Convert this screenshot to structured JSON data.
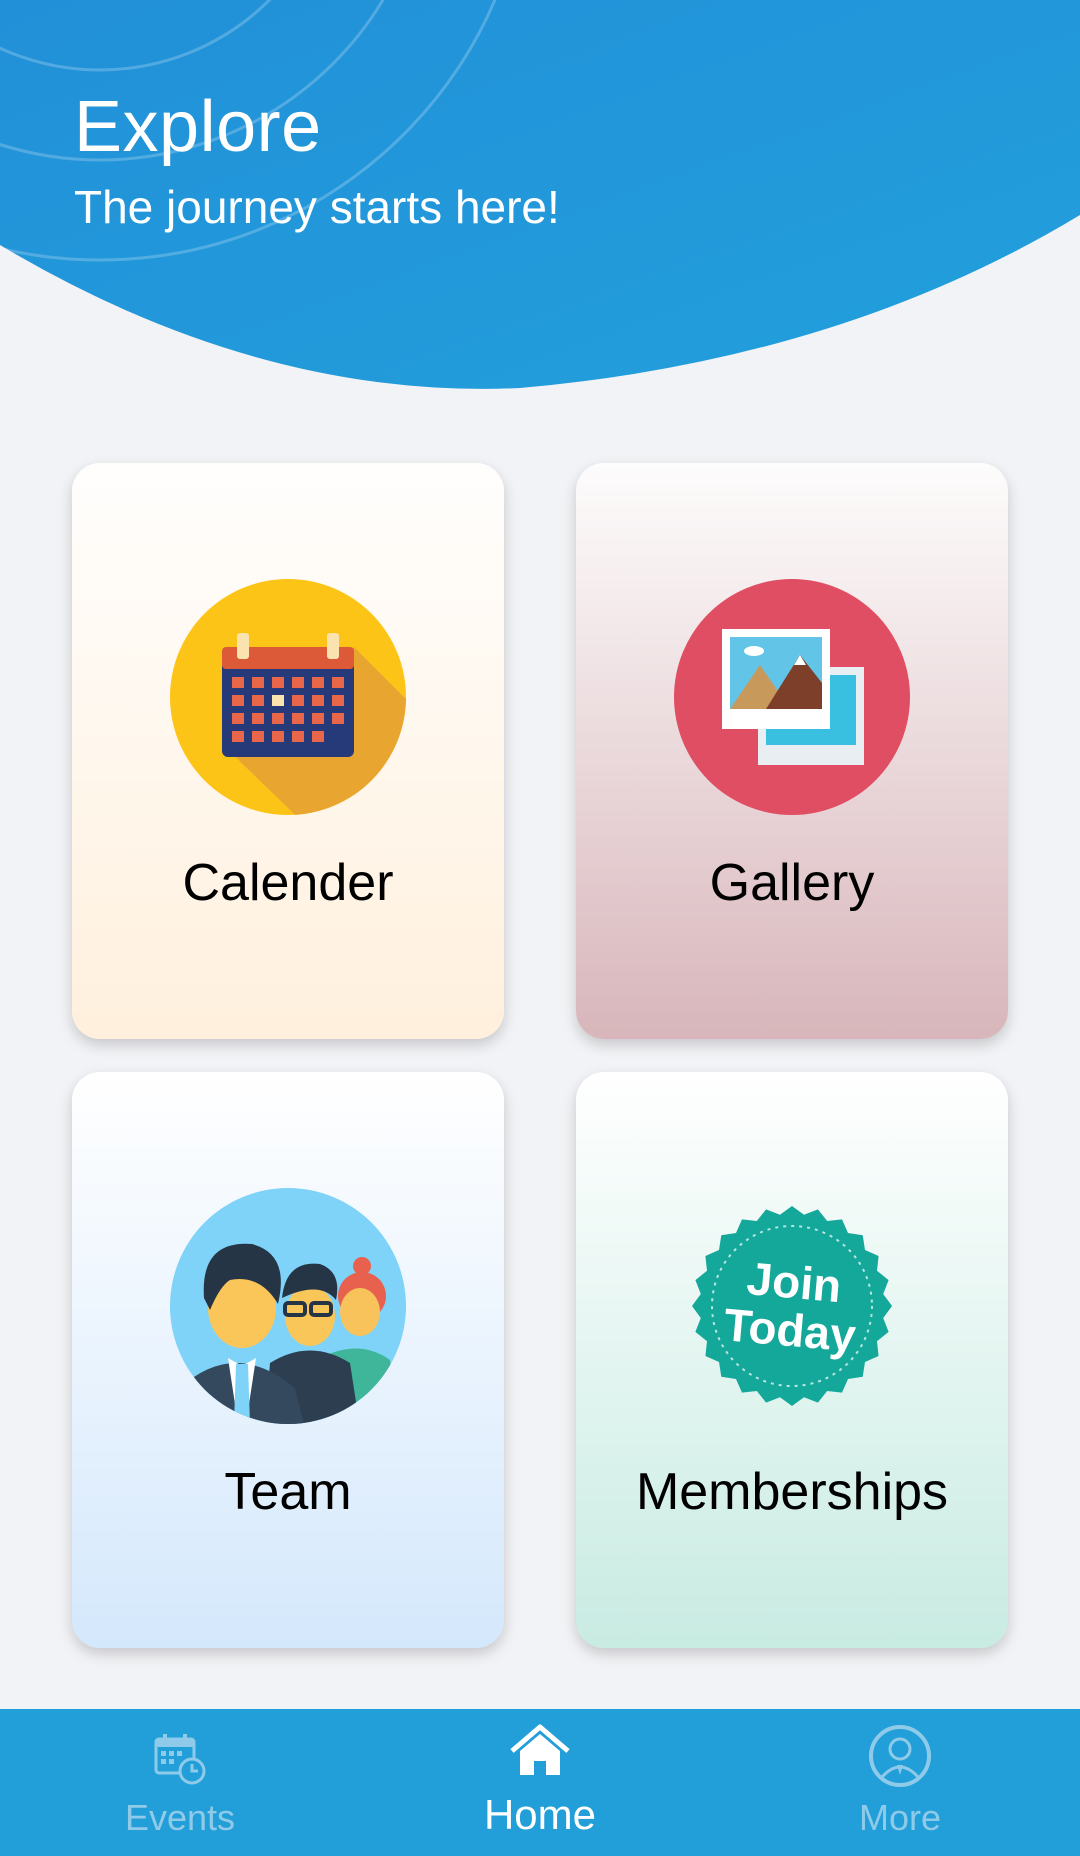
{
  "header": {
    "title": "Explore",
    "subtitle": "The journey starts here!"
  },
  "cards": [
    {
      "label": "Calender",
      "icon": "calendar-icon"
    },
    {
      "label": "Gallery",
      "icon": "gallery-icon"
    },
    {
      "label": "Team",
      "icon": "team-icon"
    },
    {
      "label": "Memberships",
      "icon": "join-today-icon",
      "badge_text": [
        "Join",
        "Today"
      ]
    }
  ],
  "nav": {
    "items": [
      {
        "label": "Events",
        "icon": "events-icon",
        "active": false
      },
      {
        "label": "Home",
        "icon": "home-icon",
        "active": true
      },
      {
        "label": "More",
        "icon": "profile-icon",
        "active": false
      }
    ]
  },
  "colors": {
    "primary": "#229ed8",
    "background": "#f2f3f6",
    "nav_inactive": "#8fcbe9"
  }
}
